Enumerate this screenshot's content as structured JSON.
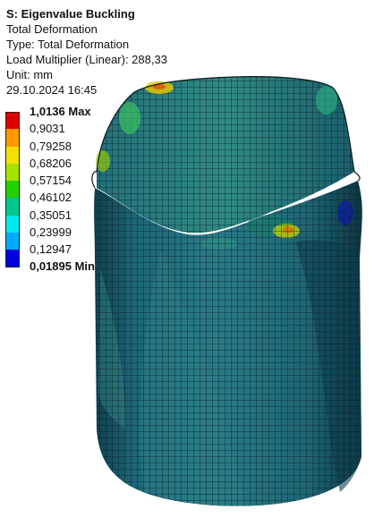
{
  "header": {
    "title": "S: Eigenvalue Buckling",
    "line2": "Total Deformation",
    "line3": "Type: Total Deformation",
    "line4": "Load Multiplier (Linear): 288,33",
    "line5": "Unit: mm",
    "line6": "29.10.2024 16:45"
  },
  "legend": {
    "max_label": "1,0136 Max",
    "v1": "0,9031",
    "v2": "0,79258",
    "v3": "0,68206",
    "v4": "0,57154",
    "v5": "0,46102",
    "v6": "0,35051",
    "v7": "0,23999",
    "v8": "0,12947",
    "min_label": "0,01895 Min",
    "colors": [
      "#e00000",
      "#ff9900",
      "#f2e000",
      "#a8e000",
      "#22d000",
      "#00c88a",
      "#00e8e8",
      "#00aaff",
      "#0000e0"
    ]
  },
  "model": {
    "icon": "deformed-cylinder-mesh",
    "base_color": "#1f6a7a",
    "mesh_color": "#0b1f26"
  }
}
